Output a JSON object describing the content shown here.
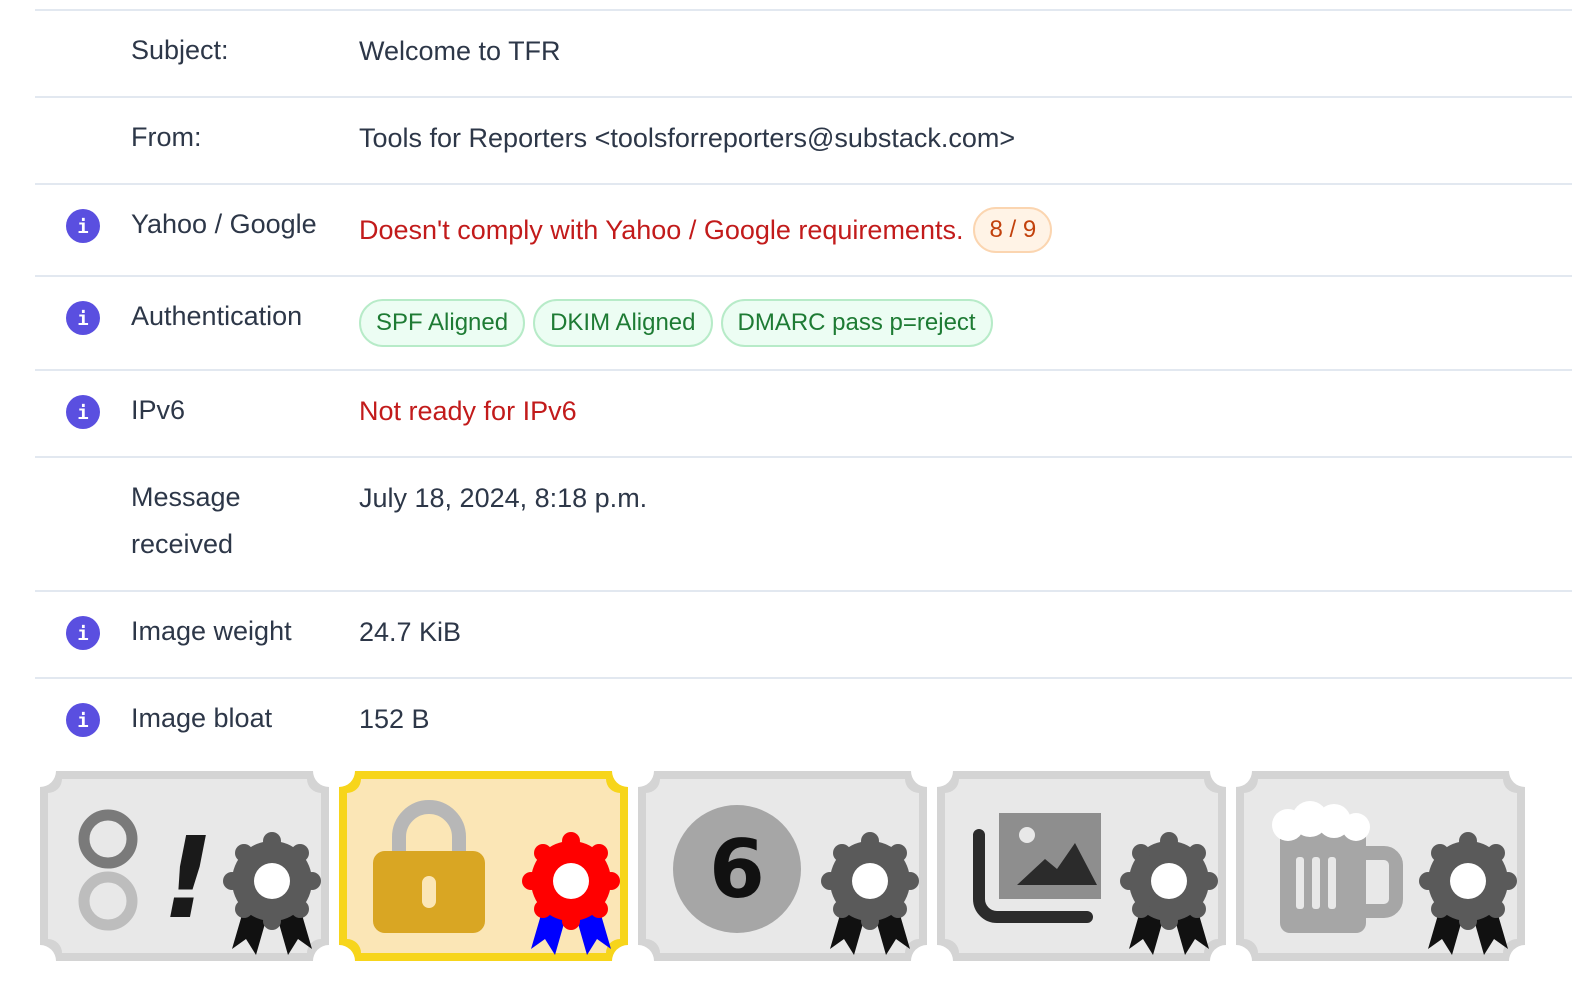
{
  "rows": [
    {
      "label": "Subject:",
      "value": "Welcome to TFR"
    },
    {
      "label": "From:",
      "value": "Tools for Reporters <toolsforreporters@substack.com>"
    },
    {
      "label": "Yahoo / Google",
      "value": "Doesn't comply with Yahoo / Google requirements.",
      "badge": "8 / 9"
    },
    {
      "label": "Authentication",
      "badges": [
        "SPF Aligned",
        "DKIM Aligned",
        "DMARC pass p=reject"
      ]
    },
    {
      "label": "IPv6",
      "value": "Not ready for IPv6"
    },
    {
      "label": "Message received",
      "value": "July 18, 2024, 8:18 p.m."
    },
    {
      "label": "Image weight",
      "value": "24.7 KiB"
    },
    {
      "label": "Image bloat",
      "value": "152 B"
    }
  ],
  "info_icon_glyph": "i",
  "badge_cards": [
    {
      "icon": "yahoo-google-icon",
      "glyph": "!",
      "achieved": false
    },
    {
      "icon": "lock-icon",
      "achieved": true
    },
    {
      "icon": "ipv6-icon",
      "glyph": "6",
      "achieved": false
    },
    {
      "icon": "images-icon",
      "achieved": false
    },
    {
      "icon": "beer-mug-icon",
      "achieved": false
    }
  ],
  "colors": {
    "info": "#5a4fe0",
    "error": "#c21b1b",
    "success": "#1e7b34",
    "warn": "#c2410c",
    "badge_active_border": "#f7d51b",
    "badge_active_bg": "#fbe6b6",
    "ribbon_active": "#ff0000",
    "ribbon_active_tails": "#0000ff"
  }
}
